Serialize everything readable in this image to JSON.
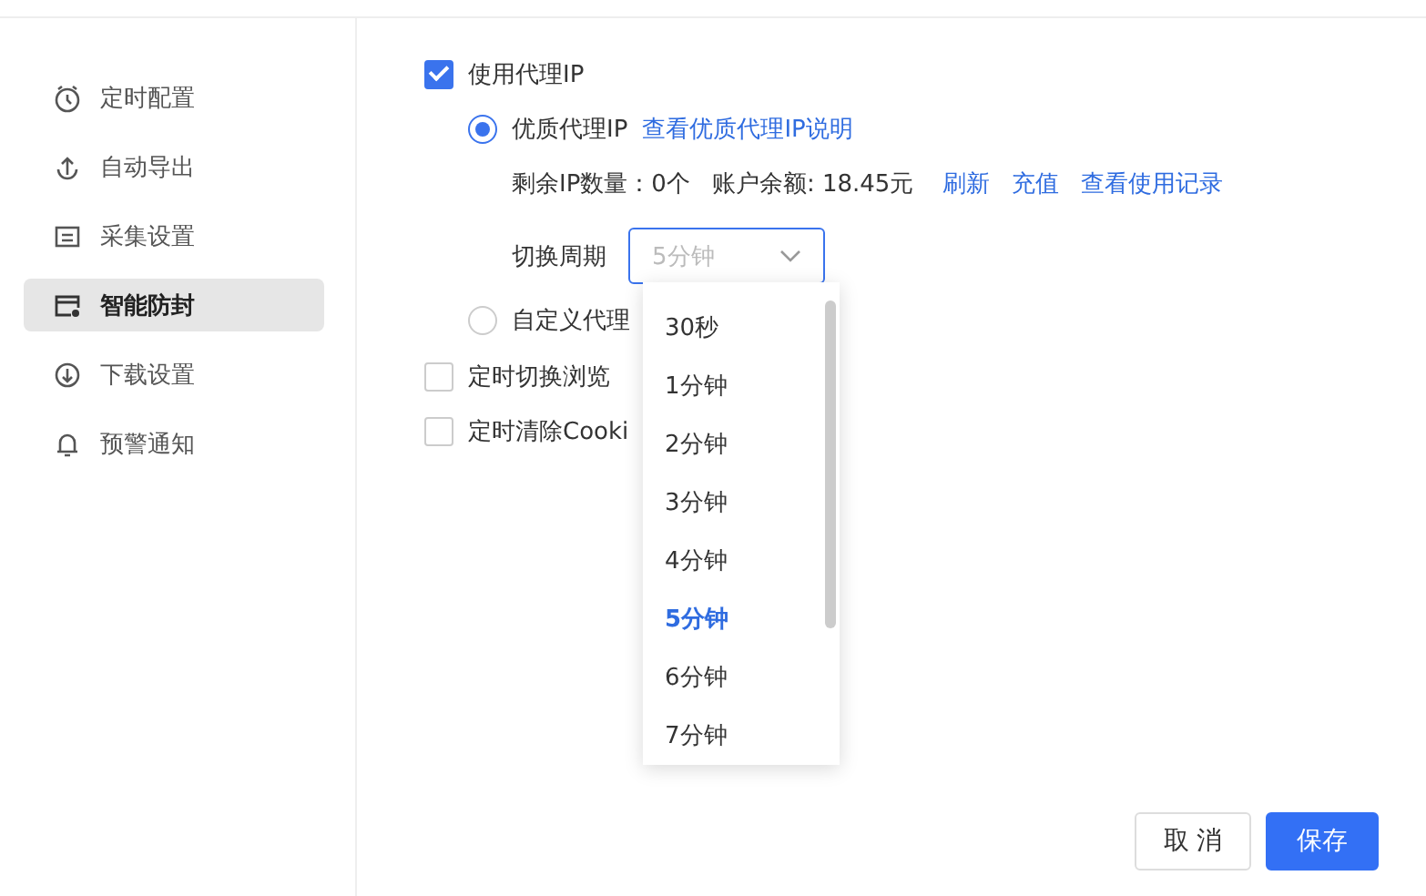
{
  "sidebar": {
    "items": [
      {
        "label": "定时配置",
        "selected": false
      },
      {
        "label": "自动导出",
        "selected": false
      },
      {
        "label": "采集设置",
        "selected": false
      },
      {
        "label": "智能防封",
        "selected": true
      },
      {
        "label": "下载设置",
        "selected": false
      },
      {
        "label": "预警通知",
        "selected": false
      }
    ]
  },
  "proxy": {
    "label": "使用代理IP",
    "checked": true,
    "options": [
      {
        "label": "优质代理IP",
        "selected": true,
        "link": "查看优质代理IP说明"
      },
      {
        "label": "自定义代理",
        "selected": false
      }
    ],
    "stats": {
      "remaining": "剩余IP数量：0个",
      "balance": "账户余额: 18.45元",
      "links": [
        "刷新",
        "充值",
        "查看使用记录"
      ]
    },
    "cycle": {
      "label": "切换周期",
      "value": "5分钟",
      "expanded": true,
      "options": [
        {
          "label": "30秒",
          "selected": false
        },
        {
          "label": "1分钟",
          "selected": false
        },
        {
          "label": "2分钟",
          "selected": false
        },
        {
          "label": "3分钟",
          "selected": false
        },
        {
          "label": "4分钟",
          "selected": false
        },
        {
          "label": "5分钟",
          "selected": true
        },
        {
          "label": "6分钟",
          "selected": false
        },
        {
          "label": "7分钟",
          "selected": false
        }
      ]
    }
  },
  "settings": [
    {
      "label": "定时切换浏览",
      "checked": false
    },
    {
      "label": "定时清除Cooki",
      "checked": false
    }
  ],
  "buttons": [
    {
      "label": "取 消",
      "kind": "secondary"
    },
    {
      "label": "保存",
      "kind": "primary"
    }
  ]
}
